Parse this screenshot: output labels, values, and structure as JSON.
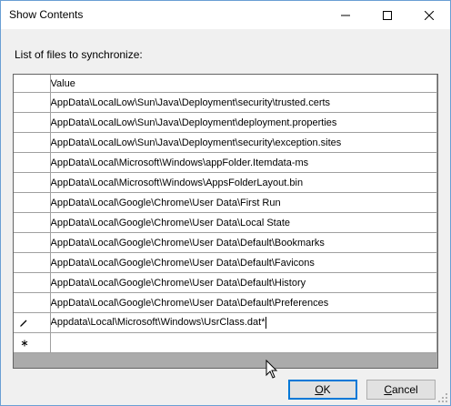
{
  "window": {
    "title": "Show Contents"
  },
  "titlebar": {
    "minimize_icon": "minimize-icon",
    "maximize_icon": "maximize-icon",
    "close_icon": "close-icon"
  },
  "list_label": "List of files to synchronize:",
  "grid": {
    "column_header": "Value",
    "rows": [
      {
        "value": "AppData\\LocalLow\\Sun\\Java\\Deployment\\security\\trusted.certs"
      },
      {
        "value": "AppData\\LocalLow\\Sun\\Java\\Deployment\\deployment.properties"
      },
      {
        "value": "AppData\\LocalLow\\Sun\\Java\\Deployment\\security\\exception.sites"
      },
      {
        "value": "AppData\\Local\\Microsoft\\Windows\\appFolder.Itemdata-ms"
      },
      {
        "value": "AppData\\Local\\Microsoft\\Windows\\AppsFolderLayout.bin"
      },
      {
        "value": "AppData\\Local\\Google\\Chrome\\User Data\\First Run"
      },
      {
        "value": "AppData\\Local\\Google\\Chrome\\User Data\\Local State"
      },
      {
        "value": "AppData\\Local\\Google\\Chrome\\User Data\\Default\\Bookmarks"
      },
      {
        "value": "AppData\\Local\\Google\\Chrome\\User Data\\Default\\Favicons"
      },
      {
        "value": "AppData\\Local\\Google\\Chrome\\User Data\\Default\\History"
      },
      {
        "value": "AppData\\Local\\Google\\Chrome\\User Data\\Default\\Preferences"
      }
    ],
    "editing_row": {
      "indicator_icon": "pencil-icon",
      "value": "Appdata\\Local\\Microsoft\\Windows\\UsrClass.dat*"
    },
    "new_row": {
      "indicator_icon": "new-row-asterisk-icon",
      "value": ""
    }
  },
  "buttons": {
    "ok": {
      "mnemonic": "O",
      "rest": "K"
    },
    "cancel": {
      "mnemonic": "C",
      "rest": "ancel"
    }
  }
}
